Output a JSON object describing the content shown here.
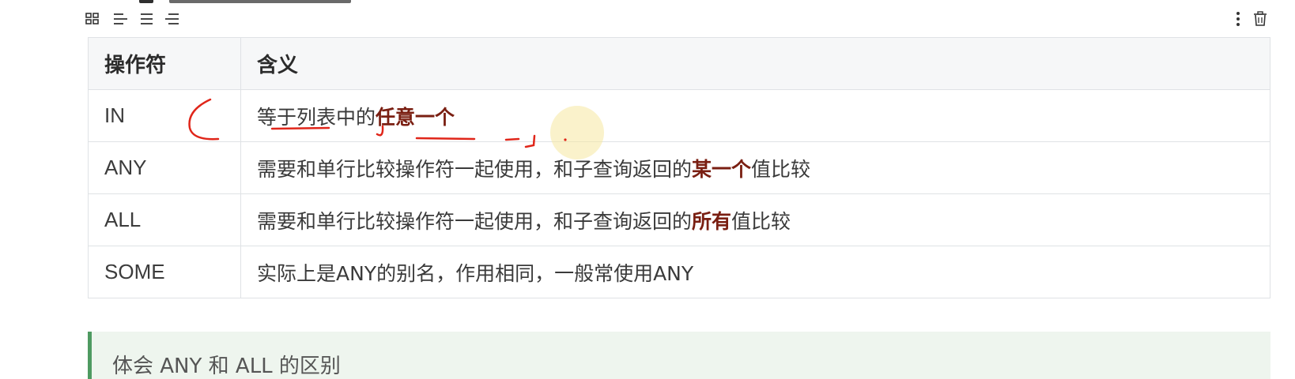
{
  "toolbar": {
    "left_icons": [
      "grid-icon",
      "align-left-icon",
      "align-center-icon",
      "align-right-icon"
    ],
    "right_icons": [
      "more-vertical-icon",
      "trash-icon"
    ]
  },
  "table": {
    "headers": [
      "操作符",
      "含义"
    ],
    "rows": [
      {
        "op": "IN",
        "plain_before": "等于列表中的",
        "emphasis": "任意一个",
        "plain_after": ""
      },
      {
        "op": "ANY",
        "plain_before": "需要和单行比较操作符一起使用，和子查询返回的",
        "emphasis": "某一个",
        "plain_after": "值比较"
      },
      {
        "op": "ALL",
        "plain_before": "需要和单行比较操作符一起使用，和子查询返回的",
        "emphasis": "所有",
        "plain_after": "值比较"
      },
      {
        "op": "SOME",
        "plain_before": "实际上是ANY的别名，作用相同，一般常使用ANY",
        "emphasis": "",
        "plain_after": ""
      }
    ]
  },
  "callout": {
    "text": "体会 ANY 和 ALL 的区别"
  },
  "colors": {
    "emphasis": "#7a1f12",
    "header_bg": "#f6f7f8",
    "border": "#dfe2e5",
    "callout_bg": "#eef5ee",
    "callout_bar": "#4e9a61",
    "annotation_red": "#e0261a",
    "cursor_highlight": "#f6e7a0"
  }
}
